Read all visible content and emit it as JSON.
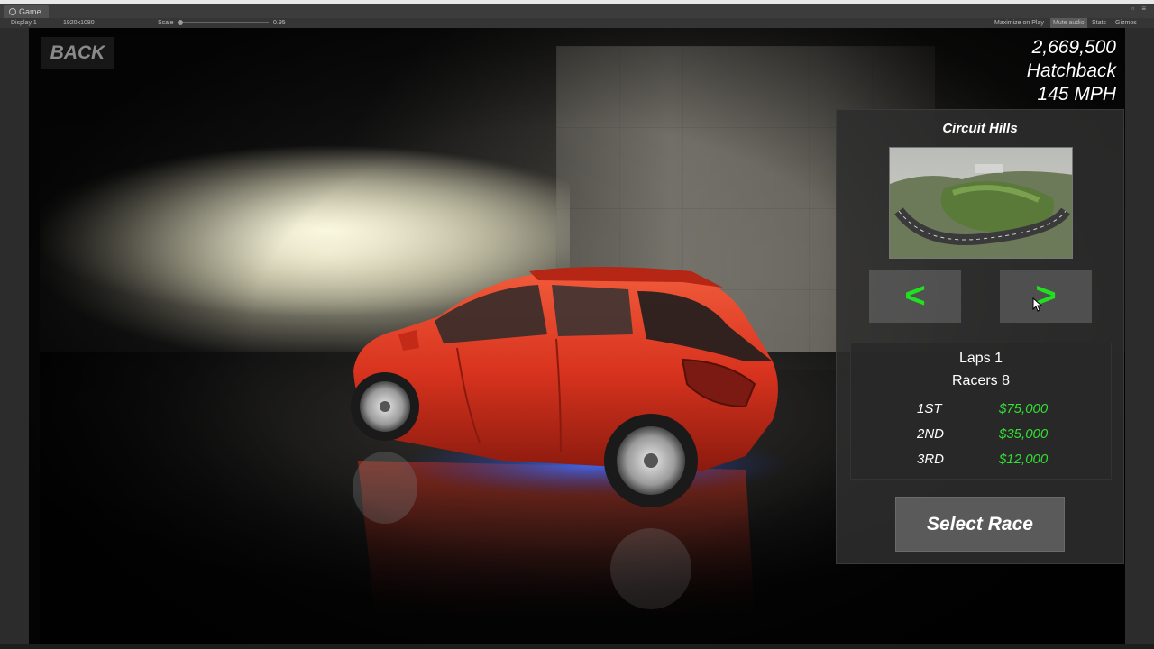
{
  "editor": {
    "tab_label": "Game",
    "display_label": "Display 1",
    "resolution_label": "1920x1080",
    "scale_label": "Scale",
    "scale_value": "0.95",
    "maximize_label": "Maximize on Play",
    "mute_label": "Mute audio",
    "stats_label": "Stats",
    "gizmos_label": "Gizmos"
  },
  "hud": {
    "back_label": "BACK",
    "car_price": "2,669,500",
    "car_type": "Hatchback",
    "car_speed": "145 MPH"
  },
  "race": {
    "track_name": "Circuit Hills",
    "prev_label": "<",
    "next_label": ">",
    "laps": "Laps 1",
    "racers": "Racers 8",
    "prizes": [
      {
        "place": "1ST",
        "amount": "$75,000"
      },
      {
        "place": "2ND",
        "amount": "$35,000"
      },
      {
        "place": "3RD",
        "amount": "$12,000"
      }
    ],
    "select_label": "Select Race"
  },
  "colors": {
    "car_body": "#d8331e",
    "underglow": "#2a5cff",
    "prize_green": "#33dd33",
    "arrow_green": "#20e020"
  },
  "icons": {
    "cursor": "mouse-cursor-icon",
    "car": "hatchback-car-icon"
  }
}
